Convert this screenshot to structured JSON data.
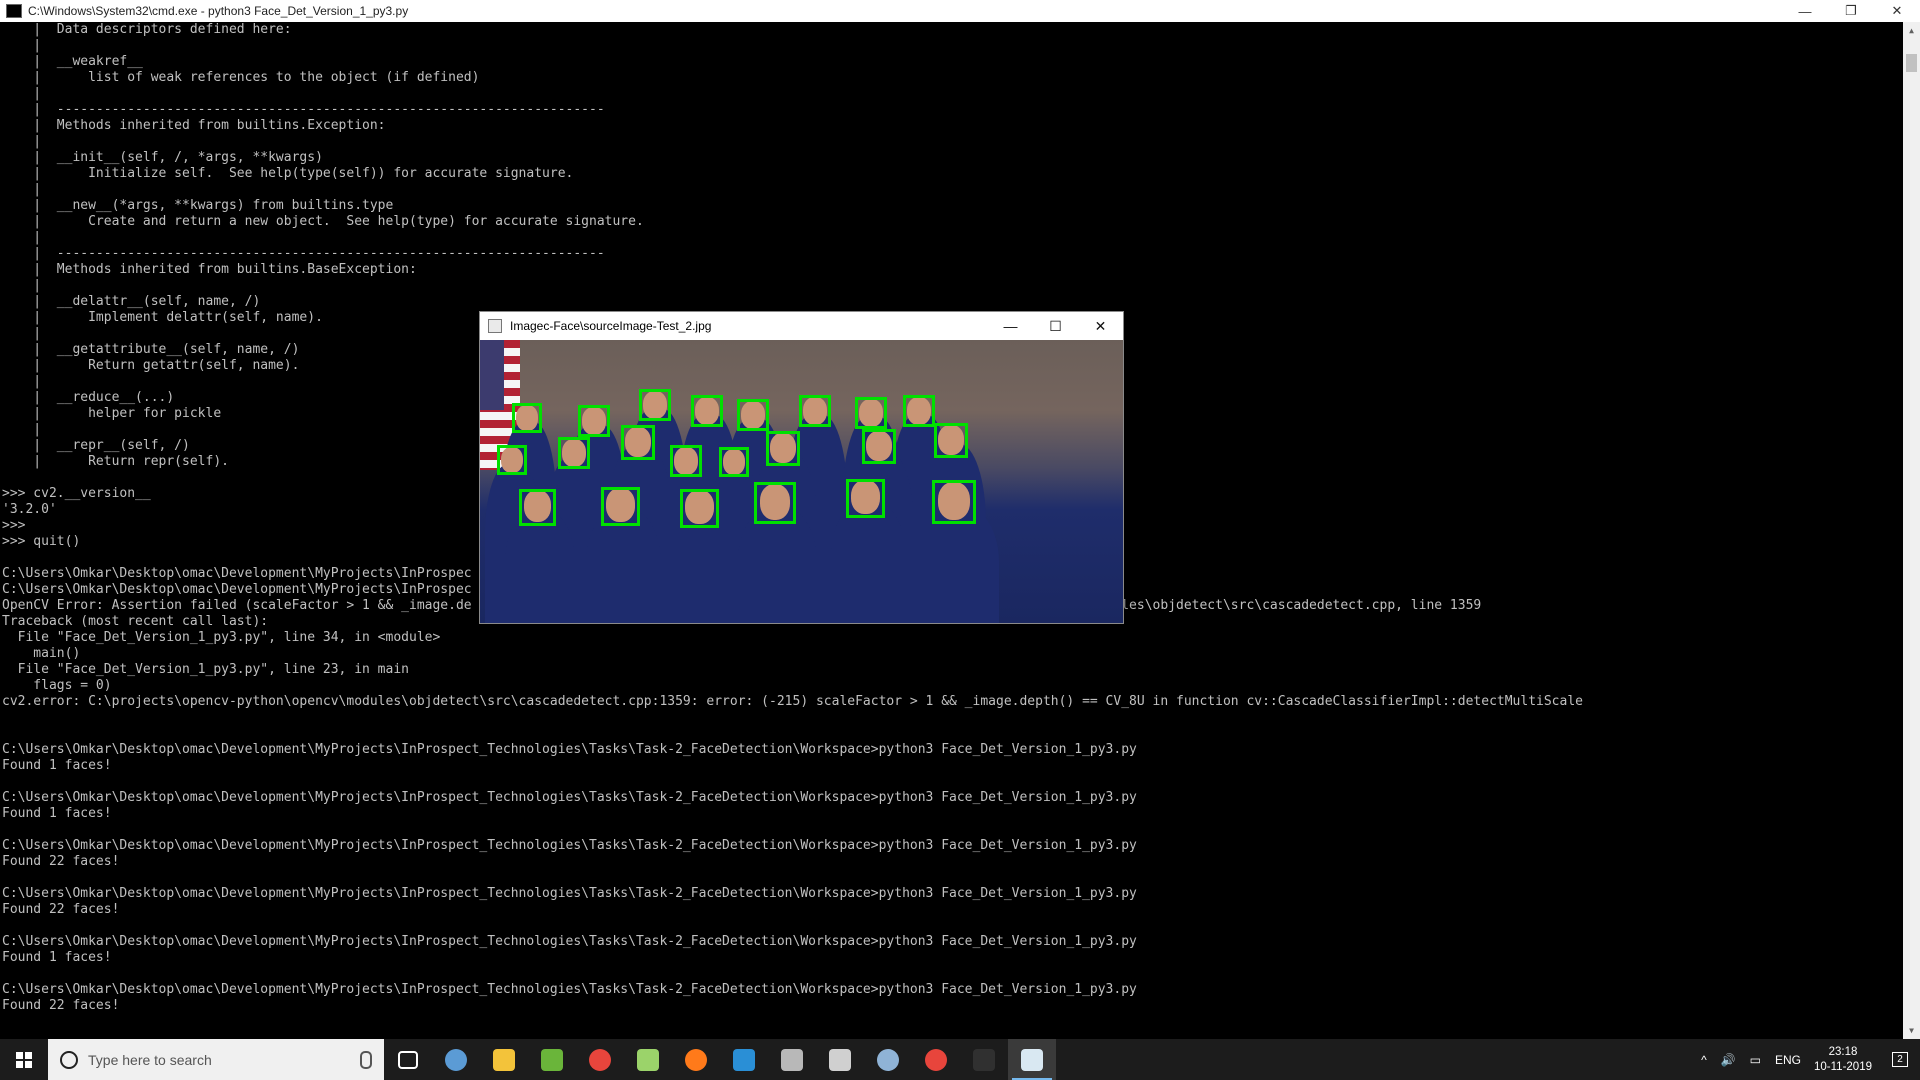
{
  "cmd_window": {
    "title": "C:\\Windows\\System32\\cmd.exe - python3  Face_Det_Version_1_py3.py",
    "minimize": "—",
    "restore": "❐",
    "close": "✕"
  },
  "console_lines": [
    "    |  Data descriptors defined here:",
    "    |",
    "    |  __weakref__",
    "    |      list of weak references to the object (if defined)",
    "    |",
    "    |  ----------------------------------------------------------------------",
    "    |  Methods inherited from builtins.Exception:",
    "    |",
    "    |  __init__(self, /, *args, **kwargs)",
    "    |      Initialize self.  See help(type(self)) for accurate signature.",
    "    |",
    "    |  __new__(*args, **kwargs) from builtins.type",
    "    |      Create and return a new object.  See help(type) for accurate signature.",
    "    |",
    "    |  ----------------------------------------------------------------------",
    "    |  Methods inherited from builtins.BaseException:",
    "    |",
    "    |  __delattr__(self, name, /)",
    "    |      Implement delattr(self, name).",
    "    |",
    "    |  __getattribute__(self, name, /)",
    "    |      Return getattr(self, name).",
    "    |",
    "    |  __reduce__(...)",
    "    |      helper for pickle",
    "    |",
    "    |  __repr__(self, /)",
    "    |      Return repr(self).",
    "",
    ">>> cv2.__version__",
    "'3.2.0'",
    ">>>",
    ">>> quit()",
    "",
    "C:\\Users\\Omkar\\Desktop\\omac\\Development\\MyProjects\\InProspec",
    "C:\\Users\\Omkar\\Desktop\\omac\\Development\\MyProjects\\InProspec                                                          3.py",
    "OpenCV Error: Assertion failed (scaleFactor > 1 && _image.de                                                         \\opencv-python\\opencv\\modules\\objdetect\\src\\cascadedetect.cpp, line 1359",
    "Traceback (most recent call last):",
    "  File \"Face_Det_Version_1_py3.py\", line 34, in <module>",
    "    main()",
    "  File \"Face_Det_Version_1_py3.py\", line 23, in main",
    "    flags = 0)",
    "cv2.error: C:\\projects\\opencv-python\\opencv\\modules\\objdetect\\src\\cascadedetect.cpp:1359: error: (-215) scaleFactor > 1 && _image.depth() == CV_8U in function cv::CascadeClassifierImpl::detectMultiScale",
    "",
    "",
    "C:\\Users\\Omkar\\Desktop\\omac\\Development\\MyProjects\\InProspect_Technologies\\Tasks\\Task-2_FaceDetection\\Workspace>python3 Face_Det_Version_1_py3.py",
    "Found 1 faces!",
    "",
    "C:\\Users\\Omkar\\Desktop\\omac\\Development\\MyProjects\\InProspect_Technologies\\Tasks\\Task-2_FaceDetection\\Workspace>python3 Face_Det_Version_1_py3.py",
    "Found 1 faces!",
    "",
    "C:\\Users\\Omkar\\Desktop\\omac\\Development\\MyProjects\\InProspect_Technologies\\Tasks\\Task-2_FaceDetection\\Workspace>python3 Face_Det_Version_1_py3.py",
    "Found 22 faces!",
    "",
    "C:\\Users\\Omkar\\Desktop\\omac\\Development\\MyProjects\\InProspect_Technologies\\Tasks\\Task-2_FaceDetection\\Workspace>python3 Face_Det_Version_1_py3.py",
    "Found 22 faces!",
    "",
    "C:\\Users\\Omkar\\Desktop\\omac\\Development\\MyProjects\\InProspect_Technologies\\Tasks\\Task-2_FaceDetection\\Workspace>python3 Face_Det_Version_1_py3.py",
    "Found 1 faces!",
    "",
    "C:\\Users\\Omkar\\Desktop\\omac\\Development\\MyProjects\\InProspect_Technologies\\Tasks\\Task-2_FaceDetection\\Workspace>python3 Face_Det_Version_1_py3.py",
    "Found 22 faces!"
  ],
  "viewer_window": {
    "title": "Imagec-Face\\sourceImage-Test_2.jpg",
    "minimize": "—",
    "maximize": "☐",
    "close": "✕",
    "detected_face_count": 22,
    "face_box_color": "#00e000"
  },
  "taskbar": {
    "search_placeholder": "Type here to search",
    "apps": [
      {
        "name": "task-view-icon",
        "color": "#ffffff"
      },
      {
        "name": "steam-icon",
        "color": "#5b9bd5"
      },
      {
        "name": "file-explorer-icon",
        "color": "#f3c33a"
      },
      {
        "name": "utorrent-icon",
        "color": "#6ab53a"
      },
      {
        "name": "chrome-icon",
        "color": "#e8453c"
      },
      {
        "name": "notepad-plus-icon",
        "color": "#9bd36a"
      },
      {
        "name": "firefox-icon",
        "color": "#ff7a1a"
      },
      {
        "name": "vscode-icon",
        "color": "#2a8fd6"
      },
      {
        "name": "file-manager-icon",
        "color": "#b8b8b8"
      },
      {
        "name": "calculator-icon",
        "color": "#d0d0d0"
      },
      {
        "name": "steam-icon-2",
        "color": "#8fb3d6"
      },
      {
        "name": "chrome-icon-2",
        "color": "#e8453c"
      },
      {
        "name": "cmd-icon",
        "color": "#303030"
      },
      {
        "name": "image-viewer-icon",
        "color": "#d9e8f2"
      }
    ],
    "tray": {
      "chevron": "^",
      "volume": "🔊",
      "network": "▭",
      "language": "ENG",
      "time": "23:18",
      "date": "10-11-2019",
      "notifications": "2"
    }
  }
}
